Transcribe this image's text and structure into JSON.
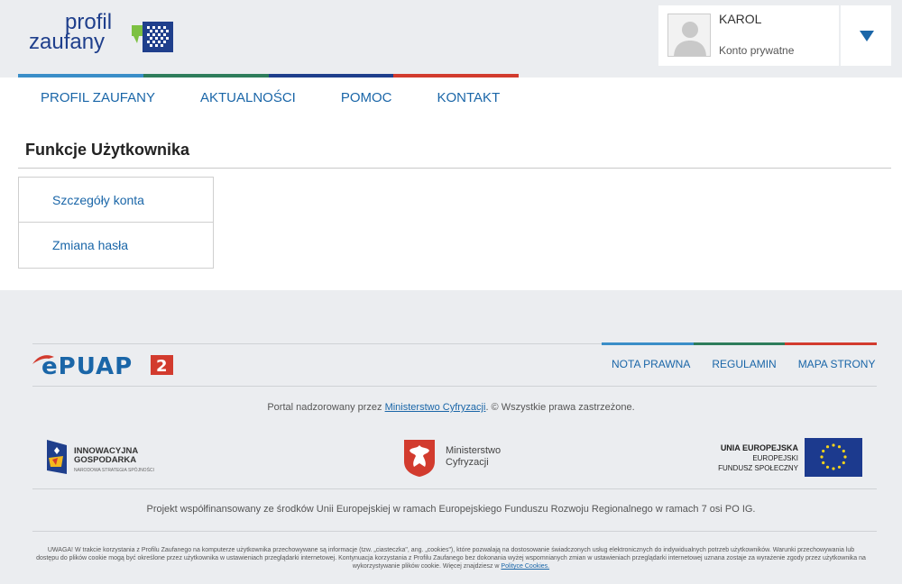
{
  "header": {
    "logo": {
      "line1": "profil",
      "line2": "zaufany"
    },
    "tricolor": [
      "#3a8ec8",
      "#2e7d5b",
      "#1f3f8c",
      "#d23b2e"
    ],
    "user": {
      "name": "KAROL",
      "type": "Konto prywatne",
      "avatar_icon": "user-silhouette-icon",
      "dropdown_icon": "caret-down-icon"
    }
  },
  "nav": {
    "items": [
      {
        "label": "PROFIL ZAUFANY"
      },
      {
        "label": "AKTUALNOŚCI"
      },
      {
        "label": "POMOC"
      },
      {
        "label": "KONTAKT"
      }
    ]
  },
  "main": {
    "title": "Funkcje Użytkownika",
    "menu": [
      {
        "label": "Szczegóły konta"
      },
      {
        "label": "Zmiana hasła"
      }
    ]
  },
  "footer": {
    "epuap_logo": "ePUAP 2",
    "links": [
      {
        "label": "NOTA PRAWNA"
      },
      {
        "label": "REGULAMIN"
      },
      {
        "label": "MAPA STRONY"
      }
    ],
    "supervised_prefix": "Portal nadzorowany przez ",
    "supervised_link": "Ministerstwo Cyfryzacji",
    "supervised_suffix": ". © Wszystkie prawa zastrzeżone.",
    "ig": {
      "line1": "INNOWACYJNA",
      "line2": "GOSPODARKA",
      "sub": "NARODOWA STRATEGIA SPÓJNOŚCI"
    },
    "mc": {
      "line1": "Ministerstwo",
      "line2": "Cyfryzacji"
    },
    "ue": {
      "line1": "UNIA EUROPEJSKA",
      "line2": "EUROPEJSKI",
      "line3": "FUNDUSZ SPOŁECZNY"
    },
    "project": "Projekt współfinansowany ze środków Unii Europejskiej w ramach Europejskiego Funduszu Rozwoju Regionalnego w ramach 7 osi PO IG.",
    "notice_text": "UWAGA! W trakcie korzystania z Profilu Zaufanego na komputerze użytkownika przechowywane są informacje (tzw. „ciasteczka\", ang. „cookies\"), które pozwalają na dostosowanie świadczonych usług elektronicznych do indywidualnych potrzeb użytkowników. Warunki przechowywania lub dostępu do plików cookie mogą być określone przez użytkownika w ustawieniach przeglądarki internetowej. Kontynuacja korzystania z Profilu Zaufanego bez dokonania wyżej wspomnianych zmian w ustawieniach przeglądarki internetowej uznana zostaje za wyrażenie zgody przez użytkownika na wykorzystywanie plików cookie. Więcej znajdziesz w ",
    "notice_link": "Polityce Cookies."
  }
}
